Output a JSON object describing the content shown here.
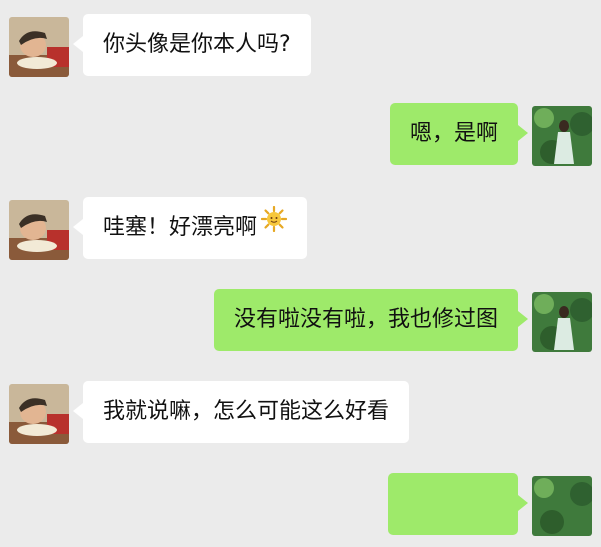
{
  "chat": {
    "messages": [
      {
        "side": "left",
        "text": "你头像是你本人吗?"
      },
      {
        "side": "right",
        "text": "嗯，是啊"
      },
      {
        "side": "left",
        "text": "哇塞！好漂亮啊",
        "emoji": "sun-emoji-icon"
      },
      {
        "side": "right",
        "text": "没有啦没有啦，我也修过图"
      },
      {
        "side": "left",
        "text": "我就说嘛，怎么可能这么好看"
      },
      {
        "side": "right",
        "text": ""
      }
    ]
  },
  "colors": {
    "background": "#ebebeb",
    "incoming_bubble": "#ffffff",
    "outgoing_bubble": "#9eea6a",
    "text": "#111111"
  }
}
